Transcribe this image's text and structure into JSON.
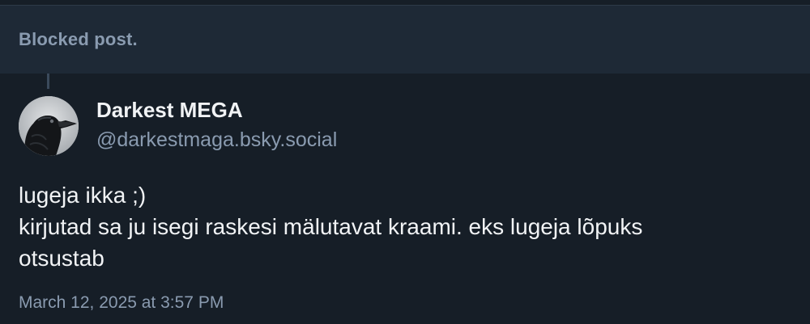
{
  "blocked_post": {
    "label": "Blocked post."
  },
  "post": {
    "author": {
      "display_name": "Darkest MEGA",
      "handle": "@darkestmaga.bsky.social",
      "avatar_icon": "crow-avatar"
    },
    "text_lines": [
      "lugeja ikka ;)",
      "kirjutad sa ju isegi raskesi mälutavat kraami. eks lugeja lõpuks",
      "otsustab"
    ],
    "timestamp": "March 12, 2025 at 3:57 PM"
  },
  "colors": {
    "background": "#161e27",
    "blocked_background": "#1e2936",
    "primary_text": "#f1f3f5",
    "secondary_text": "#8a9bb0"
  }
}
